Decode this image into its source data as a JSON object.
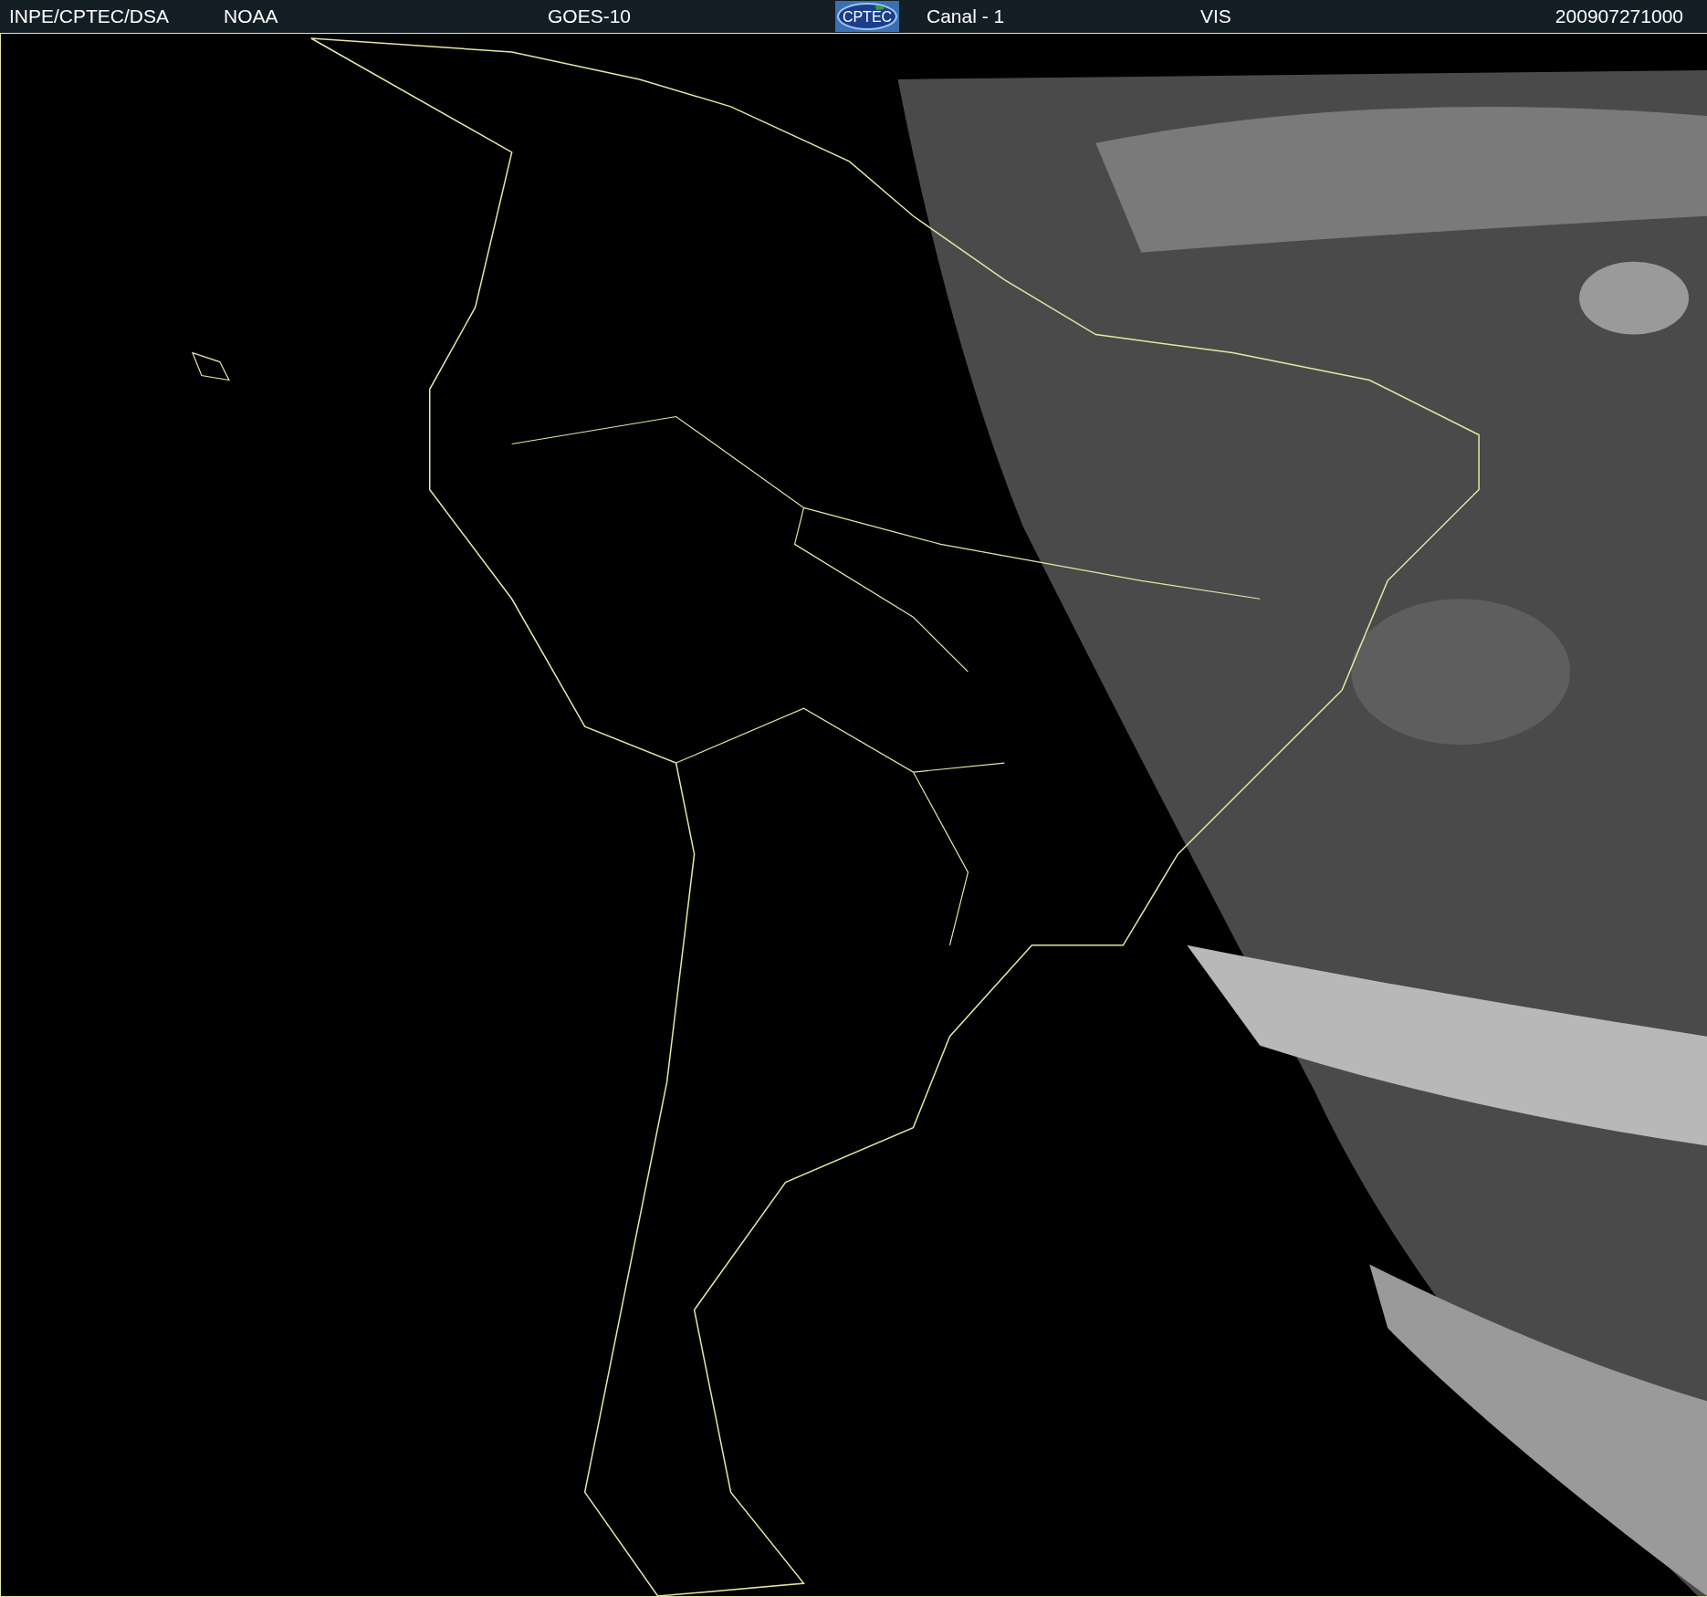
{
  "header": {
    "source": "INPE/CPTEC/DSA",
    "agency": "NOAA",
    "satellite": "GOES-10",
    "logo_text": "CPTEC",
    "channel": "Canal - 1",
    "band": "VIS",
    "timestamp": "200907271000"
  }
}
